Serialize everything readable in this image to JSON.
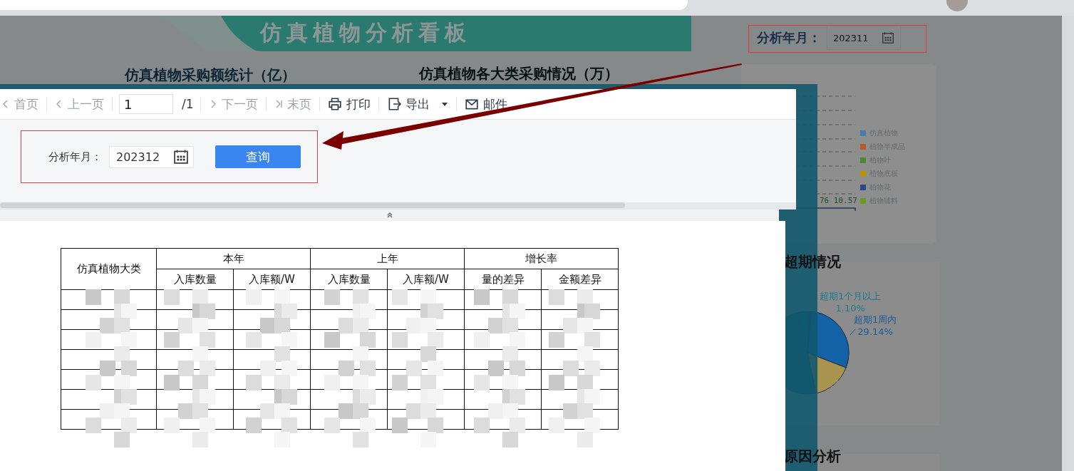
{
  "dashboard": {
    "title": "仿真植物分析看板",
    "filter": {
      "label": "分析年月：",
      "value": "202311"
    },
    "sections": [
      {
        "title": "仿真植物采购额统计（亿）"
      },
      {
        "title": "仿真植物各大类采购情况（万）"
      }
    ],
    "category_chart": {
      "legend": [
        {
          "label": "仿真植物",
          "color": "#4a7cb0"
        },
        {
          "label": "植物半成品",
          "color": "#b85a25"
        },
        {
          "label": "植物叶",
          "color": "#4a8a30"
        },
        {
          "label": "植物底板",
          "color": "#c09000"
        },
        {
          "label": "植物花",
          "color": "#2a4a90"
        },
        {
          "label": "植物辅料",
          "color": "#6a9a20"
        }
      ],
      "value_text": "76 10.57"
    },
    "overdue": {
      "title": "超期情况",
      "labels": [
        {
          "name": "超期1个月以上",
          "percent": "1.10%",
          "color": "#1a7a90"
        },
        {
          "name": "超期1周内",
          "percent": "29.14%",
          "color": "#1a5a9a"
        }
      ]
    },
    "cause": {
      "title": "原因分析"
    }
  },
  "report": {
    "toolbar": [
      {
        "kind": "first",
        "label": "首页",
        "disabled": true
      },
      {
        "kind": "prev",
        "label": "上一页",
        "disabled": true
      },
      {
        "kind": "page",
        "value": "1"
      },
      {
        "kind": "total",
        "label": "/1"
      },
      {
        "kind": "next",
        "label": "下一页",
        "disabled": true
      },
      {
        "kind": "last",
        "label": "末页",
        "disabled": true
      },
      {
        "kind": "print",
        "label": "打印",
        "disabled": false
      },
      {
        "kind": "export",
        "label": "导出",
        "disabled": false
      },
      {
        "kind": "mail",
        "label": "邮件",
        "disabled": false
      }
    ],
    "params": {
      "label": "分析年月：",
      "value": "202312",
      "button": "查询"
    },
    "table": {
      "corner": "仿真植物大类",
      "groups": [
        {
          "label": "本年",
          "columns": [
            "入库数量",
            "入库额/W"
          ]
        },
        {
          "label": "上年",
          "columns": [
            "入库数量",
            "入库额/W"
          ]
        },
        {
          "label": "增长率",
          "columns": [
            "量的差异",
            "金额差异"
          ]
        }
      ],
      "rows": [
        {
          "kind": "obscured"
        },
        {
          "kind": "obscured"
        },
        {
          "kind": "obscured"
        },
        {
          "kind": "obscured"
        },
        {
          "kind": "obscured"
        },
        {
          "kind": "obscured"
        },
        {
          "kind": "obscured"
        }
      ]
    }
  }
}
